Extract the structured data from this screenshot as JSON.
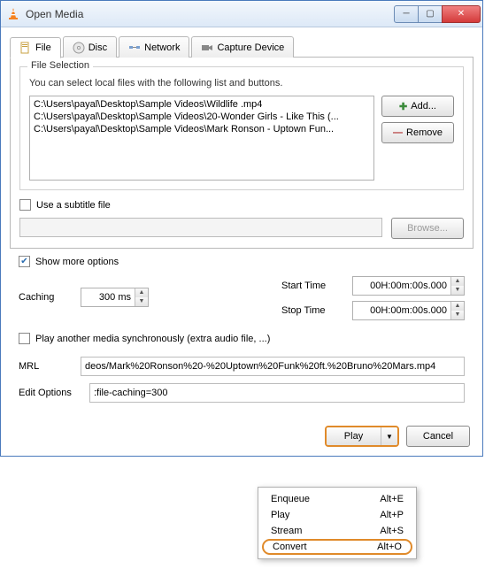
{
  "window": {
    "title": "Open Media"
  },
  "tabs": [
    {
      "label": "File"
    },
    {
      "label": "Disc"
    },
    {
      "label": "Network"
    },
    {
      "label": "Capture Device"
    }
  ],
  "file_selection": {
    "legend": "File Selection",
    "hint": "You can select local files with the following list and buttons.",
    "files": [
      "C:\\Users\\payal\\Desktop\\Sample Videos\\Wildlife .mp4",
      "C:\\Users\\payal\\Desktop\\Sample Videos\\20-Wonder Girls - Like This (...",
      "C:\\Users\\payal\\Desktop\\Sample Videos\\Mark Ronson - Uptown Fun..."
    ],
    "add_label": "Add...",
    "remove_label": "Remove"
  },
  "subtitle": {
    "checkbox_label": "Use a subtitle file",
    "browse_label": "Browse..."
  },
  "show_more": {
    "label": "Show more options",
    "checked": true
  },
  "options": {
    "caching_label": "Caching",
    "caching_value": "300 ms",
    "start_time_label": "Start Time",
    "start_time_value": "00H:00m:00s.000",
    "stop_time_label": "Stop Time",
    "stop_time_value": "00H:00m:00s.000",
    "play_another_label": "Play another media synchronously (extra audio file, ...)",
    "mrl_label": "MRL",
    "mrl_value": "deos/Mark%20Ronson%20-%20Uptown%20Funk%20ft.%20Bruno%20Mars.mp4",
    "edit_options_label": "Edit Options",
    "edit_options_value": ":file-caching=300"
  },
  "actions": {
    "play_label": "Play",
    "cancel_label": "Cancel"
  },
  "play_menu": [
    {
      "label": "Enqueue",
      "shortcut": "Alt+E"
    },
    {
      "label": "Play",
      "shortcut": "Alt+P"
    },
    {
      "label": "Stream",
      "shortcut": "Alt+S"
    },
    {
      "label": "Convert",
      "shortcut": "Alt+O",
      "highlighted": true
    }
  ]
}
